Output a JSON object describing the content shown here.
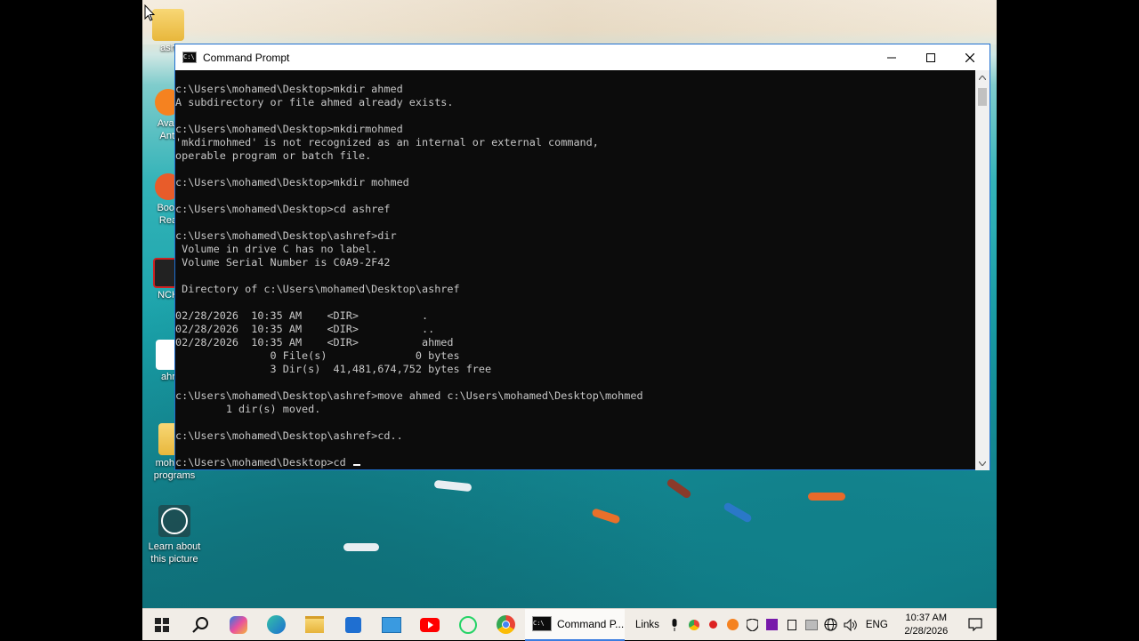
{
  "window": {
    "title": "Command Prompt"
  },
  "console": {
    "lines": [
      "c:\\Users\\mohamed\\Desktop>mkdir ahmed",
      "A subdirectory or file ahmed already exists.",
      "",
      "c:\\Users\\mohamed\\Desktop>mkdirmohmed",
      "'mkdirmohmed' is not recognized as an internal or external command,",
      "operable program or batch file.",
      "",
      "c:\\Users\\mohamed\\Desktop>mkdir mohmed",
      "",
      "c:\\Users\\mohamed\\Desktop>cd ashref",
      "",
      "c:\\Users\\mohamed\\Desktop\\ashref>dir",
      " Volume in drive C has no label.",
      " Volume Serial Number is C0A9-2F42",
      "",
      " Directory of c:\\Users\\mohamed\\Desktop\\ashref",
      "",
      "02/28/2026  10:35 AM    <DIR>          .",
      "02/28/2026  10:35 AM    <DIR>          ..",
      "02/28/2026  10:35 AM    <DIR>          ahmed",
      "               0 File(s)              0 bytes",
      "               3 Dir(s)  41,481,674,752 bytes free",
      "",
      "c:\\Users\\mohamed\\Desktop\\ashref>move ahmed c:\\Users\\mohamed\\Desktop\\mohmed",
      "        1 dir(s) moved.",
      "",
      "c:\\Users\\mohamed\\Desktop\\ashref>cd..",
      ""
    ],
    "prompt_line": "c:\\Users\\mohamed\\Desktop>cd "
  },
  "desktop": {
    "icons": [
      {
        "label": "ash",
        "kind": "folder"
      },
      {
        "label": "Avas\nAnti",
        "kind": "avast"
      },
      {
        "label": "Book\nRea",
        "kind": "book"
      },
      {
        "label": "NCH",
        "kind": "nch"
      },
      {
        "label": "ahr",
        "kind": "file"
      },
      {
        "label": "mohmed\nprograms",
        "kind": "folder"
      },
      {
        "label": "Learn about\nthis picture",
        "kind": "learn"
      }
    ]
  },
  "taskbar": {
    "task_label": "Command P...",
    "links_label": "Links",
    "lang": "ENG",
    "time": "10:37 AM",
    "date": "2/28/2026"
  },
  "colors": {
    "console_bg": "#0c0c0c",
    "console_fg": "#c7c7c7",
    "accent": "#1f6fd1"
  }
}
